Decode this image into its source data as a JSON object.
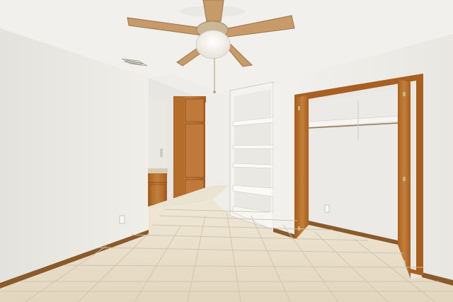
{
  "scene": {
    "room": "empty bedroom",
    "features": [
      "ceiling-fan-with-light",
      "built-in-shelves",
      "open-closet",
      "bathroom-vanity",
      "tall-wood-cabinet",
      "ceramic-tile-floor",
      "air-vent",
      "electrical-outlet"
    ]
  },
  "colors": {
    "wall": "#ecebe7",
    "ceiling": "#f1f0ed",
    "tile": "#e6dcc6",
    "wood": "#b8722e",
    "baseboard": "#8a5a2a"
  }
}
